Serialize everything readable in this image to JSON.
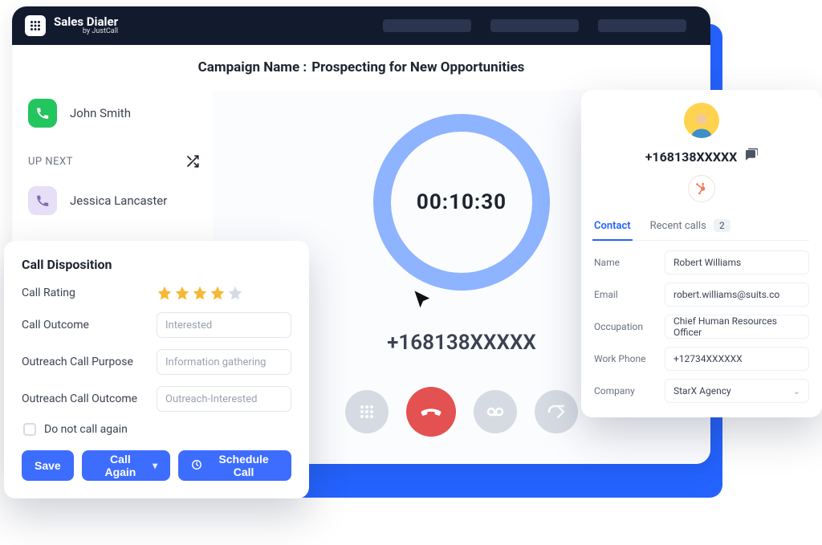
{
  "brand": {
    "name": "Sales Dialer",
    "byline": "by JustCall"
  },
  "campaign": {
    "label": "Campaign Name :",
    "name": "Prospecting for New Opportunities"
  },
  "sidebar": {
    "current_name": "John Smith",
    "upnext_label": "UP NEXT",
    "next_name": "Jessica Lancaster"
  },
  "call": {
    "timer": "00:10:30",
    "phone_number": "+168138XXXXX"
  },
  "disposition": {
    "title": "Call Disposition",
    "rating_label": "Call Rating",
    "rating_value": 4,
    "outcome_label": "Call Outcome",
    "outcome_placeholder": "Interested",
    "purpose_label": "Outreach Call Purpose",
    "purpose_placeholder": "Information gathering",
    "outreach_outcome_label": "Outreach Call Outcome",
    "outreach_outcome_placeholder": "Outreach-Interested",
    "dnc_label": "Do not call again",
    "save_label": "Save",
    "call_again_label": "Call Again",
    "schedule_label": "Schedule Call"
  },
  "contact": {
    "phone": "+168138XXXXX",
    "tabs": {
      "contact": "Contact",
      "recent": "Recent calls",
      "recent_count": "2"
    },
    "fields": {
      "name_label": "Name",
      "name_value": "Robert Williams",
      "email_label": "Email",
      "email_value": "robert.williams@suits.co",
      "occupation_label": "Occupation",
      "occupation_value": "Chief Human Resources Officer",
      "workphone_label": "Work Phone",
      "workphone_value": "+12734XXXXXX",
      "company_label": "Company",
      "company_value": "StarX Agency"
    }
  }
}
